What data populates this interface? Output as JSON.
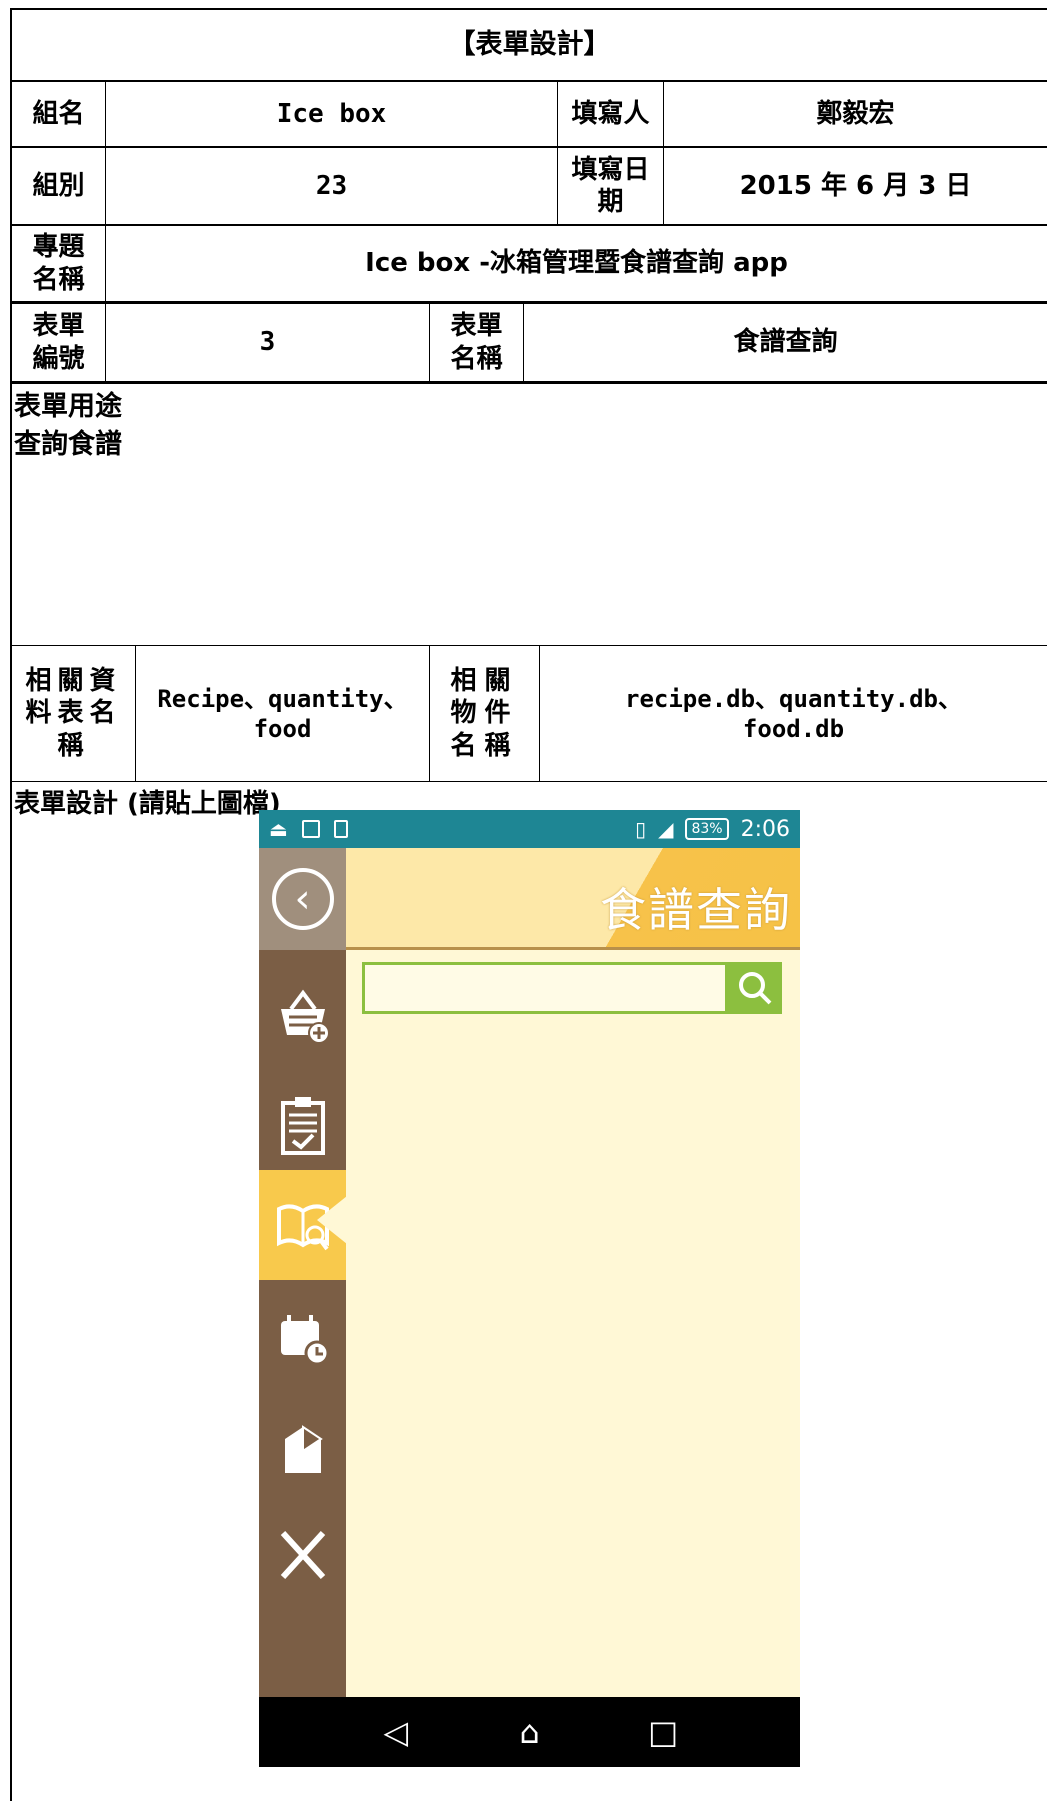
{
  "form": {
    "title": "【表單設計】",
    "group_name_label": "組名",
    "group_name": "Ice box",
    "filler_label": "填寫人",
    "filler": "鄭毅宏",
    "group_no_label": "組別",
    "group_no": "23",
    "date_label": "填寫日期",
    "date": "2015 年 6 月 3 日",
    "project_label": "專題名稱",
    "project": "Ice box -冰箱管理暨食譜查詢 app",
    "form_no_label": "表單編號",
    "form_no": "3",
    "form_name_label": "表單名稱",
    "form_name": "食譜查詢",
    "purpose_label": "表單用途",
    "purpose": "查詢食譜",
    "tables_label": "相關資料表名稱",
    "tables": "Recipe、quantity、food",
    "files_label": "相關物件名稱",
    "files_line1": "recipe.db、quantity.db、",
    "files_line2": "food.db",
    "design_label": "表單設計 (請貼上圖檔)"
  },
  "phone": {
    "status": {
      "battery": "83%",
      "time": "2:06"
    },
    "header_title": "食譜查詢",
    "search_placeholder": "",
    "sidebar_icons": [
      "back-icon",
      "basket-add-icon",
      "clipboard-check-icon",
      "recipe-book-search-icon",
      "calendar-clock-icon",
      "milk-carton-icon",
      "fork-knife-icon"
    ],
    "active_item": "recipe-book-search-icon",
    "nav": [
      "back-triangle-icon",
      "home-icon",
      "recents-icon"
    ],
    "colors": {
      "status_bar": "#1e8694",
      "sidebar": "#7b5e45",
      "active": "#f8c94c",
      "search_green": "#8cbf3f",
      "background": "#fff8d6"
    }
  }
}
